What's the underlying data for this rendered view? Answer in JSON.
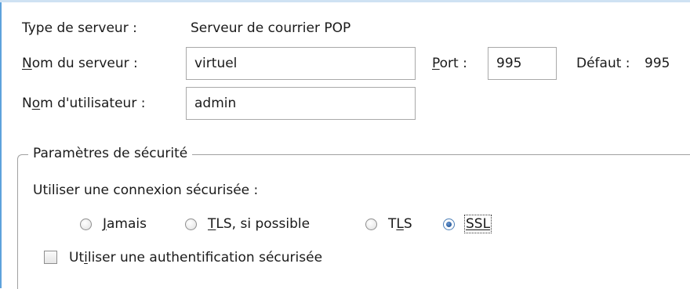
{
  "server": {
    "type_label": "Type de serveur :",
    "type_value": "Serveur de courrier POP",
    "name_label_mnemonic": "N",
    "name_label_rest": "om du serveur :",
    "name_value": "virtuel",
    "port_label_mnemonic": "P",
    "port_label_rest": "ort :",
    "port_value": "995",
    "default_label": "Défaut :",
    "default_value": "995"
  },
  "user": {
    "label_pre": "N",
    "label_mnemonic": "o",
    "label_rest": "m d'utilisateur :",
    "value": "admin"
  },
  "security": {
    "legend": "Paramètres de sécurité",
    "connection_label": "Utiliser une connexion sécurisée :",
    "options": [
      {
        "mnemonic": "J",
        "rest": "amais",
        "selected": false
      },
      {
        "mnemonic": "T",
        "rest": "LS, si possible",
        "selected": false
      },
      {
        "pre": "T",
        "mnemonic": "L",
        "rest": "S",
        "selected": false
      },
      {
        "mnemonic": "SSL",
        "rest": "",
        "selected": true
      }
    ],
    "auth_pre": "Ut",
    "auth_mnemonic": "i",
    "auth_rest": "liser une authentification sécurisée",
    "auth_checked": false
  }
}
